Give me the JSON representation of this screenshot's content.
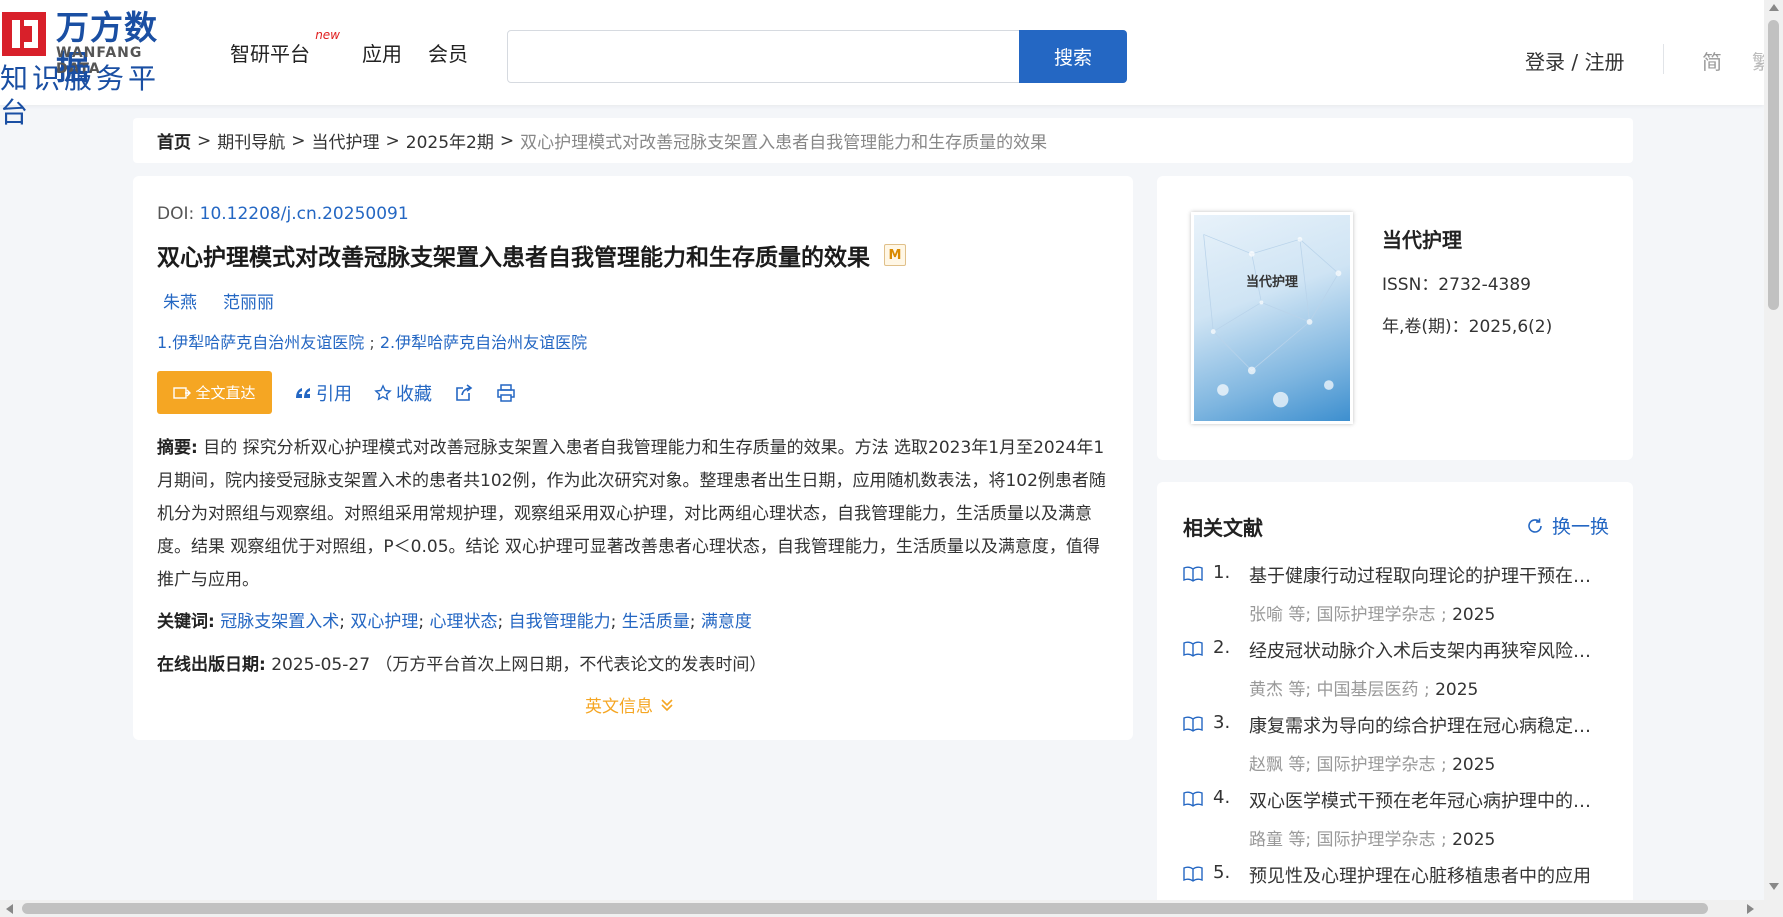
{
  "header": {
    "logo_cn": "万方数据",
    "logo_en": "WANFANG DATA",
    "logo_sub": "知识服务平台",
    "nav": [
      {
        "label": "智研平台",
        "badge": "new"
      },
      {
        "label": "应用"
      },
      {
        "label": "会员"
      }
    ],
    "search": {
      "value": "",
      "placeholder": "",
      "button": "搜索"
    },
    "login": "登录 / 注册",
    "lang": "简",
    "lang2": "繁"
  },
  "breadcrumb": {
    "home": "首页",
    "items": [
      "期刊导航",
      "当代护理",
      "2025年2期"
    ],
    "current": "双心护理模式对改善冠脉支架置入患者自我管理能力和生存质量的效果"
  },
  "article": {
    "doi_label": "DOI: ",
    "doi": "10.12208/j.cn.20250091",
    "title": "双心护理模式对改善冠脉支架置入患者自我管理能力和生存质量的效果",
    "m_badge": "M",
    "authors": [
      "朱燕",
      "范丽丽"
    ],
    "affiliations": [
      "1.伊犁哈萨克自治州友谊医院",
      "2.伊犁哈萨克自治州友谊医院"
    ],
    "affil_sep": " ; ",
    "actions": {
      "full_text": "全文直达",
      "cite": "引用",
      "favorite": "收藏"
    },
    "abstract_label": "摘要:",
    "abstract": "目的 探究分析双心护理模式对改善冠脉支架置入患者自我管理能力和生存质量的效果。方法 选取2023年1月至2024年1月期间，院内接受冠脉支架置入术的患者共102例，作为此次研究对象。整理患者出生日期，应用随机数表法，将102例患者随机分为对照组与观察组。对照组采用常规护理，观察组采用双心护理，对比两组心理状态，自我管理能力，生活质量以及满意度。结果 观察组优于对照组，P＜0.05。结论 双心护理可显著改善患者心理状态，自我管理能力，生活质量以及满意度，值得推广与应用。",
    "keywords_label": "关键词:",
    "keywords": [
      "冠脉支架置入术",
      "双心护理",
      "心理状态",
      "自我管理能力",
      "生活质量",
      "满意度"
    ],
    "online_label": "在线出版日期:",
    "online_date": "2025-05-27",
    "online_note": "（万方平台首次上网日期，不代表论文的发表时间）",
    "en_info": "英文信息"
  },
  "journal": {
    "cover_text": "当代护理",
    "name": "当代护理",
    "issn": "ISSN：2732-4389",
    "volume": "年,卷(期)：2025,6(2)"
  },
  "related": {
    "title": "相关文献",
    "refresh": "换一换",
    "items": [
      {
        "num": "1.",
        "title": "基于健康行动过程取向理论的护理干预在冠...",
        "author": "张喻",
        "source": "国际护理学杂志",
        "year": "2025"
      },
      {
        "num": "2.",
        "title": "经皮冠状动脉介入术后支架内再狭窄风险预...",
        "author": "黄杰",
        "source": "中国基层医药",
        "year": "2025"
      },
      {
        "num": "3.",
        "title": "康复需求为导向的综合护理在冠心病稳定期...",
        "author": "赵飘",
        "source": "国际护理学杂志",
        "year": "2025"
      },
      {
        "num": "4.",
        "title": "双心医学模式干预在老年冠心病护理中的效果",
        "author": "路童",
        "source": "国际护理学杂志",
        "year": "2025"
      },
      {
        "num": "5.",
        "title": "预见性及心理护理在心脏移植患者中的应用",
        "author": "",
        "source": "",
        "year": ""
      }
    ],
    "meta_etc": " 等;",
    "meta_sep": " ; "
  },
  "colors": {
    "brand_blue": "#2467c3",
    "accent_orange": "#f5a623",
    "logo_red": "#d8202a"
  }
}
